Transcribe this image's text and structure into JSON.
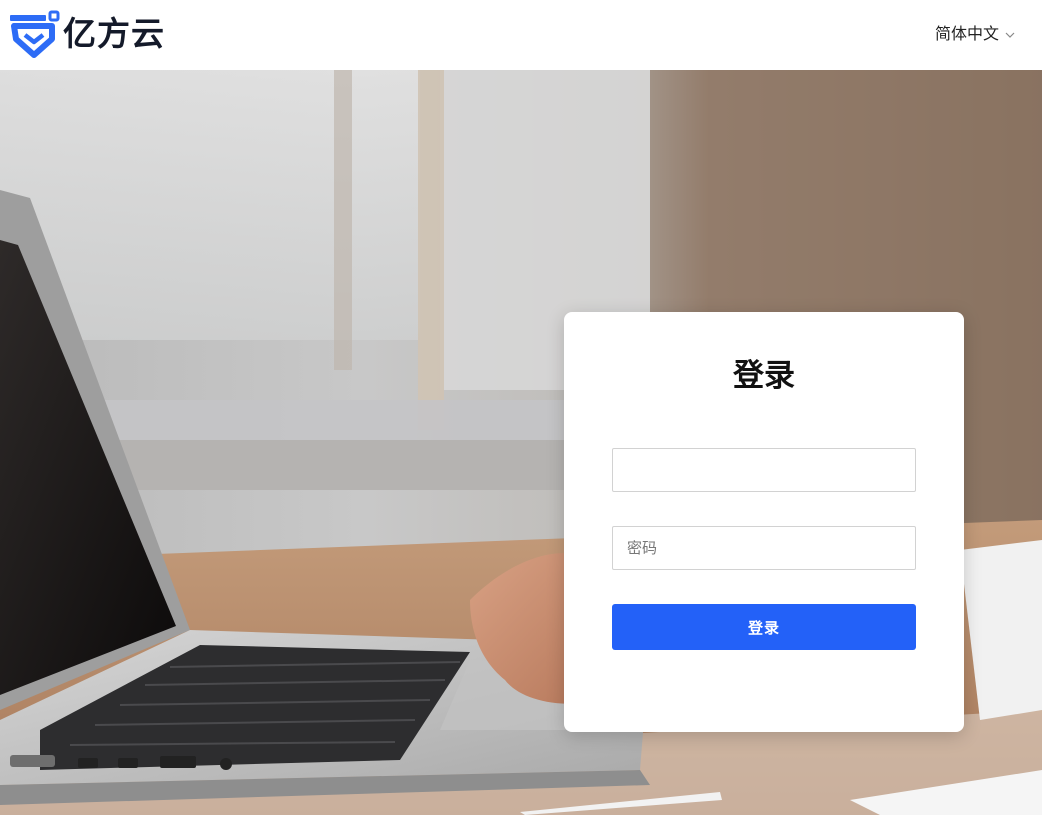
{
  "header": {
    "brand_name": "亿方云",
    "language_label": "简体中文"
  },
  "login": {
    "title": "登录",
    "username_value": "",
    "username_placeholder": "",
    "password_placeholder": "密码",
    "submit_label": "登录"
  },
  "colors": {
    "brand_blue": "#2361f8",
    "logo_dark": "#141a2a",
    "logo_blue": "#2d6cf6"
  },
  "icons": {
    "logo": "yifangyun-logo-icon",
    "language_dropdown": "chevron-down-icon"
  }
}
